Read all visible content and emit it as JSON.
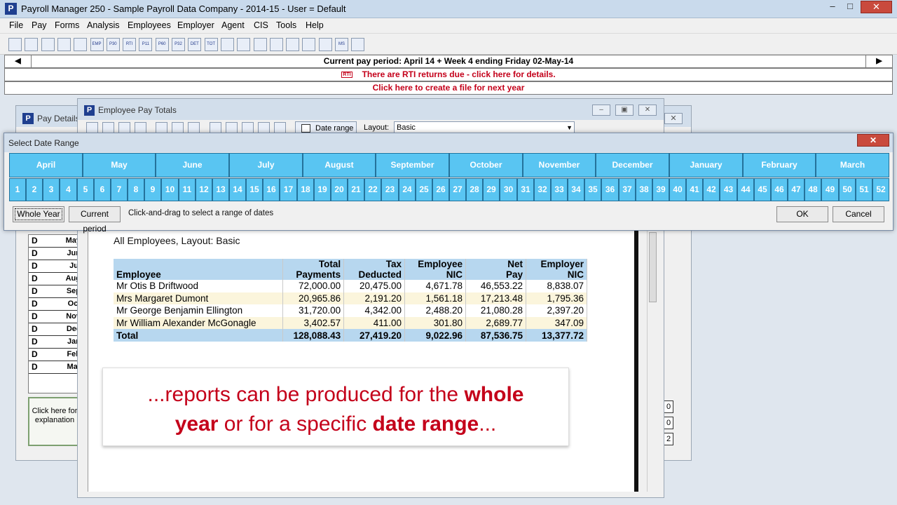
{
  "app": {
    "icon_letter": "P",
    "title": "Payroll Manager 250  -  Sample Payroll Data Company  -  2014-15  -  User = Default",
    "controls": {
      "minimize": "–",
      "maximize": "□",
      "close": "✕"
    }
  },
  "menu": [
    "File",
    "Pay",
    "Forms",
    "Analysis",
    "Employees",
    "Employer",
    "Agent",
    "CIS",
    "Tools",
    "Help"
  ],
  "toolbar": {
    "buttons": [
      "open-folder-icon",
      "save-icon",
      "folder-up-icon",
      "grid-icon",
      "document-icon",
      "emp-form-icon",
      "p30-form-icon",
      "rti-icon",
      "p11-form-icon",
      "p60-form-icon",
      "p32-form-icon",
      "det-form-icon",
      "tot-form-icon",
      "tick-icon",
      "coins-icon",
      "calculator-icon",
      "factory-icon",
      "wrench-icon",
      "chart-icon",
      "globe-folder-icon",
      "ms-icon",
      "web-icon"
    ],
    "labels": {
      "emp-form-icon": "EMP",
      "p30-form-icon": "P30",
      "rti-icon": "RTI",
      "p11-form-icon": "P11",
      "p60-form-icon": "P60",
      "p32-form-icon": "P32",
      "det-form-icon": "DET",
      "tot-form-icon": "TOT",
      "ms-icon": "MS"
    }
  },
  "status": {
    "period": "Current pay period: April 14 + Week 4 ending Friday 02-May-14",
    "prev": "◀",
    "next": "▶",
    "rti_icon_label": "RTI",
    "rti": "There are RTI returns due - click here for details.",
    "next_year": "Click here to create a file for next year"
  },
  "pay_details": {
    "icon_letter": "P",
    "title": "Pay Details",
    "close": "✕",
    "rows": [
      {
        "flag": "D",
        "month": "May"
      },
      {
        "flag": "D",
        "month": "Jun"
      },
      {
        "flag": "D",
        "month": "Jul"
      },
      {
        "flag": "D",
        "month": "Aug"
      },
      {
        "flag": "D",
        "month": "Sep"
      },
      {
        "flag": "D",
        "month": "Oct"
      },
      {
        "flag": "D",
        "month": "Nov"
      },
      {
        "flag": "D",
        "month": "Dec"
      },
      {
        "flag": "D",
        "month": "Jan"
      },
      {
        "flag": "D",
        "month": "Feb"
      },
      {
        "flag": "D",
        "month": "Mar"
      }
    ],
    "explain": "Click here for explanation",
    "box_values": [
      "0",
      "0",
      "2"
    ]
  },
  "emp_pay_totals": {
    "icon_letter": "P",
    "title": "Employee Pay Totals",
    "controls": {
      "minimize": "–",
      "maximize": "▣",
      "close": "✕"
    },
    "date_range_button": "Date range",
    "layout_label": "Layout:",
    "layout_value": "Basic",
    "subtitle": "All Employees, Layout: Basic",
    "table": {
      "headers": [
        [
          "",
          "Employee"
        ],
        [
          "Total",
          "Payments"
        ],
        [
          "Tax",
          "Deducted"
        ],
        [
          "Employee",
          "NIC"
        ],
        [
          "Net",
          "Pay"
        ],
        [
          "Employer",
          "NIC"
        ]
      ],
      "rows": [
        [
          "Mr Otis B Driftwood",
          "72,000.00",
          "20,475.00",
          "4,671.78",
          "46,553.22",
          "8,838.07"
        ],
        [
          "Mrs Margaret Dumont",
          "20,965.86",
          "2,191.20",
          "1,561.18",
          "17,213.48",
          "1,795.36"
        ],
        [
          "Mr George Benjamin Ellington",
          "31,720.00",
          "4,342.00",
          "2,488.20",
          "21,080.28",
          "2,397.20"
        ],
        [
          "Mr William Alexander McGonagle",
          "3,402.57",
          "411.00",
          "301.80",
          "2,689.77",
          "347.09"
        ]
      ],
      "total": [
        "Total",
        "128,088.43",
        "27,419.20",
        "9,022.96",
        "87,536.75",
        "13,377.72"
      ]
    }
  },
  "caption": {
    "line1_pre": "...reports can be produced for the ",
    "line1_bold": "whole",
    "line2_bold1": "year",
    "line2_mid": " or for a specific ",
    "line2_bold2": "date range",
    "line2_post": "..."
  },
  "date_range": {
    "title": "Select Date Range",
    "close": "✕",
    "months": [
      "April",
      "May",
      "June",
      "July",
      "August",
      "September",
      "October",
      "November",
      "December",
      "January",
      "February",
      "March"
    ],
    "weeks": [
      "1",
      "2",
      "3",
      "4",
      "5",
      "6",
      "7",
      "8",
      "9",
      "10",
      "11",
      "12",
      "13",
      "14",
      "15",
      "16",
      "17",
      "18",
      "19",
      "20",
      "21",
      "22",
      "23",
      "24",
      "25",
      "26",
      "27",
      "28",
      "29",
      "30",
      "31",
      "32",
      "33",
      "34",
      "35",
      "36",
      "37",
      "38",
      "39",
      "40",
      "41",
      "42",
      "43",
      "44",
      "45",
      "46",
      "47",
      "48",
      "49",
      "50",
      "51",
      "52"
    ],
    "whole_year": "Whole Year",
    "current_period": "Current period",
    "hint": "Click-and-drag to select a range of dates",
    "ok": "OK",
    "cancel": "Cancel"
  }
}
